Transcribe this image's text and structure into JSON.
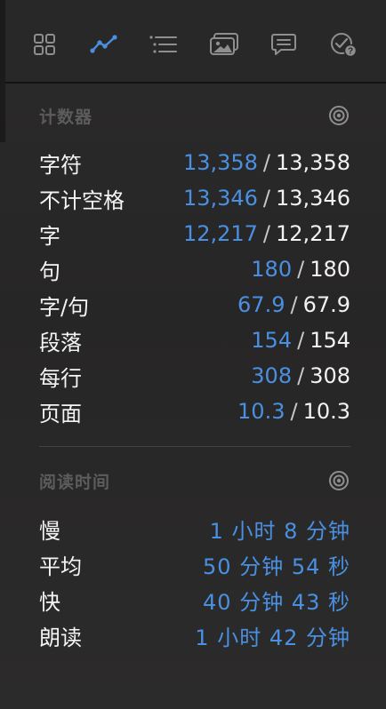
{
  "toolbar": {
    "tools": [
      {
        "name": "grid-icon",
        "active": false
      },
      {
        "name": "trend-chart-icon",
        "active": true
      },
      {
        "name": "outline-list-icon",
        "active": false
      },
      {
        "name": "images-icon",
        "active": false
      },
      {
        "name": "comments-icon",
        "active": false
      },
      {
        "name": "check-help-icon",
        "active": false
      }
    ]
  },
  "counter": {
    "title": "计数器",
    "rows": [
      {
        "label": "字符",
        "value": "13,358",
        "total": "13,358"
      },
      {
        "label": "不计空格",
        "value": "13,346",
        "total": "13,346"
      },
      {
        "label": "字",
        "value": "12,217",
        "total": "12,217"
      },
      {
        "label": "句",
        "value": "180",
        "total": "180"
      },
      {
        "label": "字/句",
        "value": "67.9",
        "total": "67.9"
      },
      {
        "label": "段落",
        "value": "154",
        "total": "154"
      },
      {
        "label": "每行",
        "value": "308",
        "total": "308"
      },
      {
        "label": "页面",
        "value": "10.3",
        "total": "10.3"
      }
    ]
  },
  "reading_time": {
    "title": "阅读时间",
    "rows": [
      {
        "label": "慢",
        "value": "1 小时 8 分钟"
      },
      {
        "label": "平均",
        "value": "50 分钟 54 秒"
      },
      {
        "label": "快",
        "value": "40 分钟 43 秒"
      },
      {
        "label": "朗读",
        "value": "1 小时 42 分钟"
      }
    ]
  },
  "colors": {
    "accent": "#4a90e2",
    "icon": "#8e8e8e",
    "background": "#292828"
  }
}
